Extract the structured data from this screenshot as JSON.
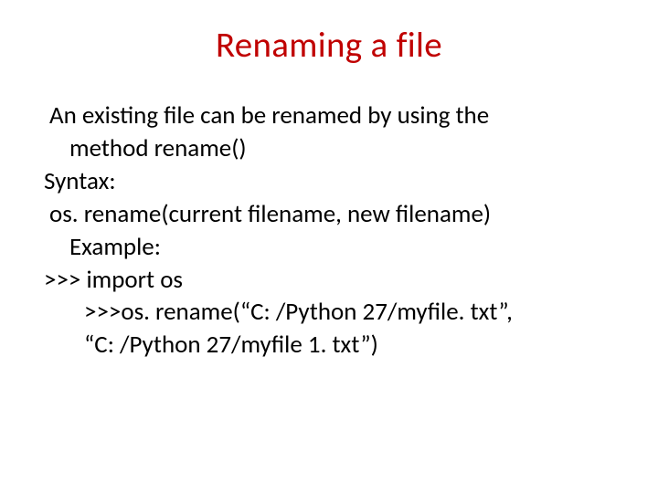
{
  "slide": {
    "title": "Renaming a file",
    "lines": {
      "l1": "An existing file can be renamed by using the",
      "l2": "method rename()",
      "l3": "Syntax:",
      "l4": "os. rename(current filename, new filename)",
      "l5": "Example:",
      "l6": ">>> import os",
      "l7": ">>>os. rename(“C: /Python 27/myfile. txt”,",
      "l8": "“C: /Python 27/myfile 1. txt”)"
    }
  }
}
